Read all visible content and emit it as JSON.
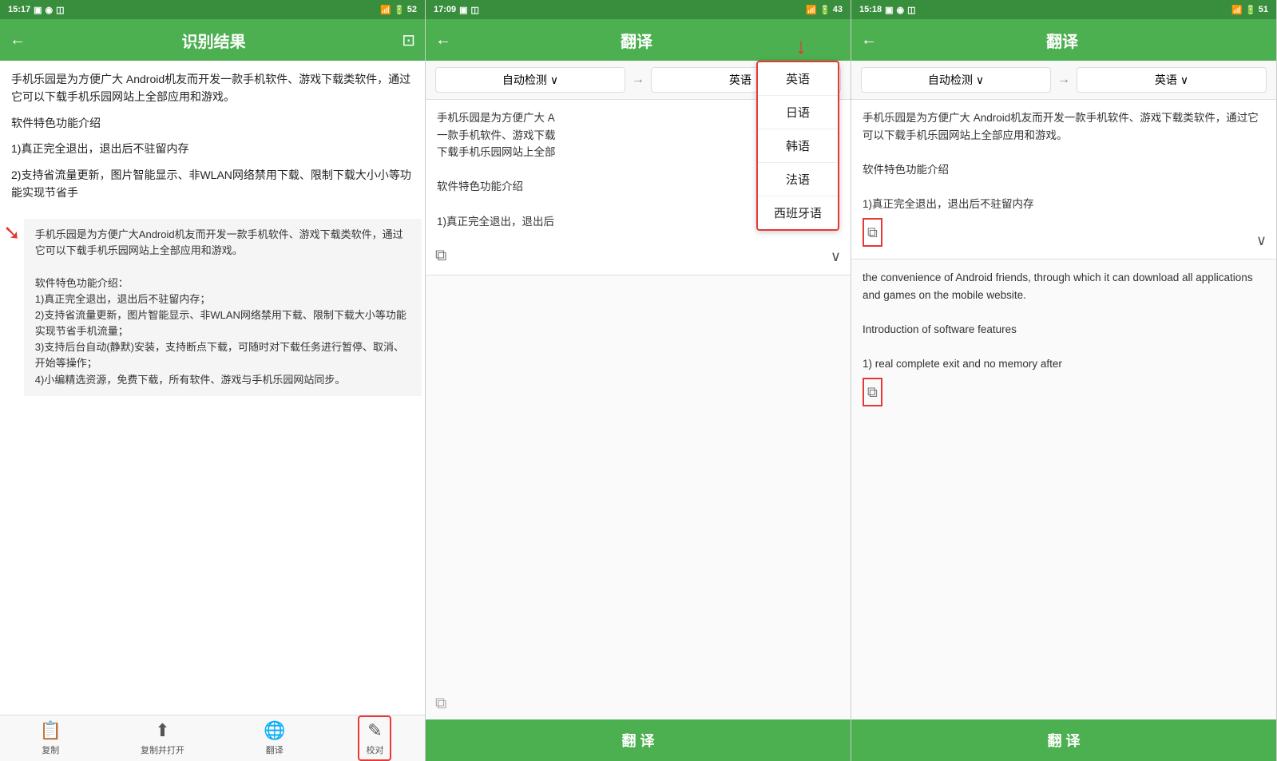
{
  "panel1": {
    "status": {
      "time": "15:17",
      "battery": "52",
      "signal": "WiFi"
    },
    "header": {
      "title": "识别结果",
      "back": "←",
      "scan_icon": "⊡"
    },
    "main_text": "手机乐园是为方便广大  Android机友而开发一款手机软件、游戏下载类软件，通过它可以下载手机乐园网站上全部应用和游戏。\n\n软件特色功能介绍\n\n1)真正完全退出，退出后不驻留内存\n\n2)支持省流量更新，图片智能显示、非WLAN网络禁用下载、限制下载大小小等功能实现节省手",
    "secondary_text": "手机乐园是为方便广大Android机友而开发一款手机软件、游戏下载类软件，通过它可以下载手机乐园网站上全部应用和游戏。\n\n软件特色功能介绍：\n1)真正完全退出，退出后不驻留内存；\n2)支持省流量更新，图片智能显示、非WLAN网络禁用下载、限制下载大小等功能实现节省手机流量；\n3)支持后台自动(静默)安装，支持断点下载，可随时对下载任务进行暂停、取消、开始等操作；\n4)小编精选资源，免费下载，所有软件、游戏与手机乐园网站同步。",
    "toolbar": {
      "copy": "复制",
      "copy_open": "复制并打开",
      "translate": "翻译",
      "proofread": "校对"
    }
  },
  "panel2": {
    "status": {
      "time": "17:09",
      "battery": "43"
    },
    "header": {
      "title": "翻译",
      "back": "←"
    },
    "source_lang": "自动检测",
    "arrow": "→",
    "target_lang": "英语",
    "source_text": "手机乐园是为方便广大  A\n一款手机软件、游戏下载\n下载手机乐园网站上全部\n\n软件特色功能介绍\n\n1)真正完全退出，退出后",
    "dropdown": {
      "items": [
        "英语",
        "日语",
        "韩语",
        "法语",
        "西班牙语"
      ]
    },
    "translate_btn": "翻 译",
    "red_arrow_label": "↓"
  },
  "panel3": {
    "status": {
      "time": "15:18",
      "battery": "51"
    },
    "header": {
      "title": "翻译",
      "back": "←"
    },
    "source_lang": "自动检测",
    "arrow": "→",
    "target_lang": "英语",
    "source_text": "手机乐园是为方便广大  Android机友而开发一款手机软件、游戏下载类软件，通过它可以下载手机乐园网站上全部应用和游戏。\n\n软件特色功能介绍\n\n1)真正完全退出，退出后不驻留内存",
    "result_text": "the convenience of Android friends, through which it can download all applications and games on the mobile website.\n\nIntroduction of software features\n\n1) real complete exit and no memory after",
    "translate_btn": "翻 译"
  },
  "icons": {
    "back": "←",
    "scan": "⊡",
    "copy": "📋",
    "share": "↑",
    "translate": "🌐",
    "proofread": "✎",
    "chevron_down": "∨",
    "chevron_up": "∧",
    "copy_small": "⧉"
  }
}
